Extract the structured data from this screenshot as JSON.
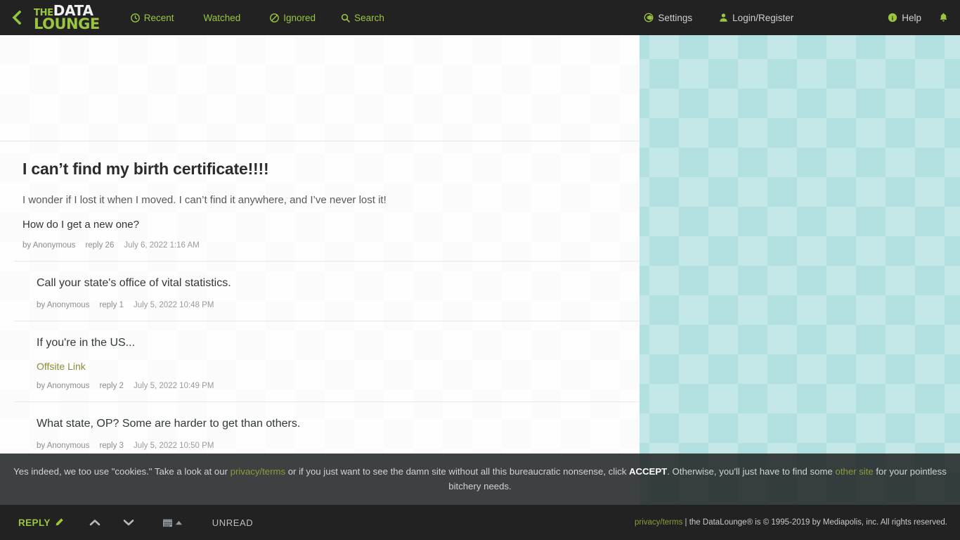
{
  "nav": {
    "back_icon": "chevron-left-icon",
    "logo": {
      "line1a": "THE",
      "line1b": "DATA",
      "line2": "LOUNGE"
    },
    "items": [
      {
        "label": "Recent",
        "icon": "clock-icon"
      },
      {
        "label": "Watched",
        "icon": ""
      },
      {
        "label": "Ignored",
        "icon": "ban-icon"
      },
      {
        "label": "Search",
        "icon": "search-icon"
      }
    ],
    "right_items": [
      {
        "label": "Settings",
        "icon": "gear-icon"
      },
      {
        "label": "Login/Register",
        "icon": "user-icon"
      },
      {
        "label": "Help",
        "icon": "info-circle-icon"
      }
    ],
    "bell_icon": "bell-icon"
  },
  "thread": {
    "op": {
      "title": "I can’t find my birth certificate!!!!",
      "body": [
        "I wonder if I lost it when I moved. I can’t find it anywhere, and I’ve never lost it!",
        "How do I get a new one?"
      ],
      "author": "by Anonymous",
      "reply": "reply 26",
      "date": "July 6, 2022 1:16 AM"
    },
    "replies": [
      {
        "text": "Call your state's office of vital statistics.",
        "link": "",
        "author": "by Anonymous",
        "reply": "reply 1",
        "date": "July 5, 2022 10:48 PM"
      },
      {
        "text": "If you're in the US...",
        "link": "Offsite Link",
        "author": "by Anonymous",
        "reply": "reply 2",
        "date": "July 5, 2022 10:49 PM"
      },
      {
        "text": "What state, OP? Some are harder to get than others.",
        "link": "",
        "author": "by Anonymous",
        "reply": "reply 3",
        "date": "July 5, 2022 10:50 PM"
      }
    ]
  },
  "cookie_banner": {
    "part1": "Yes indeed, we too use \"cookies.\" Take a look at our ",
    "link1": "privacy/terms",
    "part2": " or if you just want to see the damn site without all this bureaucratic nonsense, click ",
    "accept": "ACCEPT",
    "part3": ". Otherwise, you'll just have to find some ",
    "link2": "other site",
    "part4": " for your pointless bitchery needs."
  },
  "bottombar": {
    "reply_label": "REPLY",
    "reply_icon": "pencil-icon",
    "up_icon": "chevron-up-icon",
    "down_icon": "chevron-down-icon",
    "calendar_icon": "calendar-icon",
    "caret_icon": "caret-up-icon",
    "unread_label": "UNREAD",
    "footer_link": "privacy/terms",
    "footer_text": " | the DataLounge® is © 1995-2019 by Mediapolis, inc. All rights reserved."
  },
  "colors": {
    "brand_green": "#9ac63f",
    "nav_bg": "#222222",
    "panel_bg": "#fbfbfb",
    "page_bg": "#b2dfdf",
    "link_olive": "#8d8c32"
  }
}
